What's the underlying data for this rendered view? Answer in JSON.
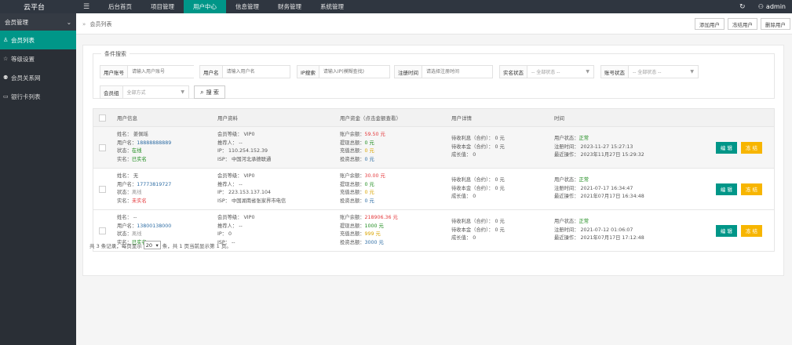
{
  "app": {
    "logo": "云平台"
  },
  "topnav": {
    "items": [
      {
        "label": "后台首页"
      },
      {
        "label": "项目管理"
      },
      {
        "label": "用户中心"
      },
      {
        "label": "信息管理"
      },
      {
        "label": "财务管理"
      },
      {
        "label": "系统管理"
      }
    ],
    "user": "admin"
  },
  "sidebar": {
    "group": "会员管理",
    "items": [
      {
        "label": "会员列表",
        "icon": "user-icon"
      },
      {
        "label": "等级设置",
        "icon": "star-icon"
      },
      {
        "label": "会员关系网",
        "icon": "users-icon"
      },
      {
        "label": "银行卡列表",
        "icon": "card-icon"
      }
    ]
  },
  "breadcrumb": {
    "current": "会员列表"
  },
  "toolbar": {
    "add": "添加用户",
    "freeze": "冻结用户",
    "delete": "删除用户"
  },
  "search": {
    "legend": "条件搜索",
    "account_label": "用户账号",
    "account_placeholder": "请输入用户账号",
    "name_label": "用户名",
    "name_placeholder": "请输入用户名",
    "ip_label": "IP搜索",
    "ip_placeholder": "请输入IP(模糊查找)",
    "regtime_label": "注册时间",
    "regtime_placeholder": "请选择注册时间",
    "realname_label": "实名状态",
    "realname_value": "-- 全部状态 --",
    "acct_status_label": "账号状态",
    "acct_status_value": "-- 全部状态 --",
    "group_label": "会员组",
    "group_value": "全部方式",
    "button": "搜 索"
  },
  "table": {
    "headers": [
      "用户信息",
      "用户资料",
      "用户资金（点击金额查看）",
      "用户详情",
      "时间"
    ],
    "edit_label": "编 辑",
    "freeze_label": "冻 结",
    "rows": [
      {
        "info": {
          "name": "姓名：  姜佩瑶",
          "username_label": "用户名：",
          "username": "18888888889",
          "status_label": "状态：",
          "status": "在线",
          "real_label": "实名：",
          "real": "已实名"
        },
        "profile": {
          "level": "会员等级：  VIP0",
          "referrer": "推荐人：  --",
          "ip": "IP：  110.254.152.39",
          "isp": "ISP：  中国河北承德联通"
        },
        "funds": {
          "balance_label": "账户余额：",
          "balance": "59.50 元",
          "withdraw_label": "提现总额：",
          "withdraw": "0 元",
          "recharge_label": "充值总额：",
          "recharge": "0 元",
          "invest_label": "投资总额：",
          "invest": "0 元"
        },
        "detail": {
          "interest": "待收利息（合约）：  0 元",
          "principal": "待收本金（合约）：  0 元",
          "growth": "成长值：  0"
        },
        "time": {
          "state_label": "用户状态：",
          "state": "正常",
          "reg": "注册时间：  2023-11-27 15:27:13",
          "last": "最近操作：  2023年11月27日 15:29:32"
        }
      },
      {
        "info": {
          "name": "姓名：  无",
          "username_label": "用户名：",
          "username": "17773819727",
          "status_label": "状态：",
          "status": "离线",
          "real_label": "实名：",
          "real": "未实名"
        },
        "profile": {
          "level": "会员等级：  VIP0",
          "referrer": "推荐人：  --",
          "ip": "IP：  223.153.137.104",
          "isp": "ISP：  中国湖南省张家界市电信"
        },
        "funds": {
          "balance_label": "账户余额：",
          "balance": "30.00 元",
          "withdraw_label": "提现总额：",
          "withdraw": "0 元",
          "recharge_label": "充值总额：",
          "recharge": "0 元",
          "invest_label": "投资总额：",
          "invest": "0 元"
        },
        "detail": {
          "interest": "待收利息（合约）：  0 元",
          "principal": "待收本金（合约）：  0 元",
          "growth": "成长值：  0"
        },
        "time": {
          "state_label": "用户状态：",
          "state": "正常",
          "reg": "注册时间：  2021-07-17 16:34:47",
          "last": "最近操作：  2021年07月17日 16:34:48"
        }
      },
      {
        "info": {
          "name": "姓名：  --",
          "username_label": "用户名：",
          "username": "13800138000",
          "status_label": "状态：",
          "status": "离线",
          "real_label": "实名：",
          "real": "已实名"
        },
        "profile": {
          "level": "会员等级：  VIP0",
          "referrer": "推荐人：  --",
          "ip": "IP：  0",
          "isp": "ISP：  --"
        },
        "funds": {
          "balance_label": "账户余额：",
          "balance": "218906.36 元",
          "withdraw_label": "提现总额：",
          "withdraw": "1000 元",
          "recharge_label": "充值总额：",
          "recharge": "999 元",
          "invest_label": "投资总额：",
          "invest": "3000 元"
        },
        "detail": {
          "interest": "待收利息（合约）：  0 元",
          "principal": "待收本金（合约）：  0 元",
          "growth": "成长值：  0"
        },
        "time": {
          "state_label": "用户状态：",
          "state": "正常",
          "reg": "注册时间：  2021-07-12 01:06:07",
          "last": "最近操作：  2021年07月17日 17:12:48"
        }
      }
    ]
  },
  "pager": {
    "prefix": "共 3 条记录，每页显示",
    "size": "20",
    "suffix": "条，共 1 页当前显示第 1 页。"
  }
}
